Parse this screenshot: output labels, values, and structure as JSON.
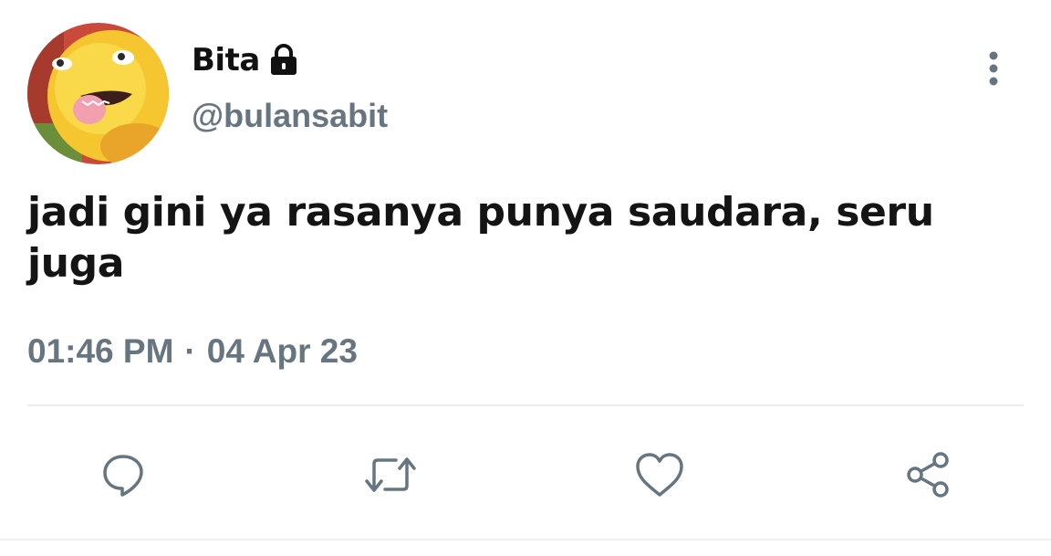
{
  "header": {
    "display_name": "Bita",
    "handle": "@bulansabit",
    "avatar": "avatar-image",
    "badge_icon": "lock-icon",
    "menu_icon": "more-vertical-icon"
  },
  "tweet": {
    "text": "jadi gini ya rasanya punya saudara, seru juga",
    "time": "01:46 PM",
    "separator": "·",
    "date": "04 Apr 23"
  },
  "actions": [
    {
      "icon": "reply-icon"
    },
    {
      "icon": "retweet-icon"
    },
    {
      "icon": "like-icon"
    },
    {
      "icon": "share-icon"
    }
  ],
  "colors": {
    "text_primary": "#141414",
    "text_secondary": "#66757f",
    "icon": "#66757f",
    "divider": "#e6ecf0",
    "background": "#ffffff"
  }
}
